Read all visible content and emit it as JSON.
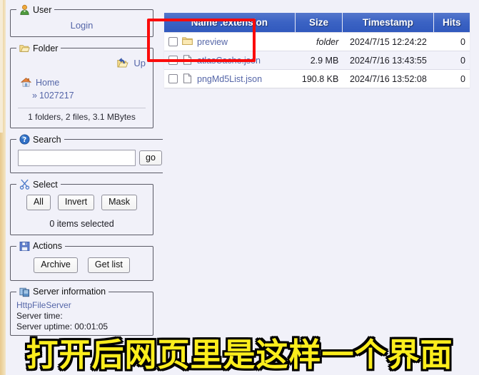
{
  "sidebar": {
    "user": {
      "legend": "User",
      "icon": "user-icon",
      "login_label": "Login"
    },
    "folder": {
      "legend": "Folder",
      "icon": "folder-open-icon",
      "up_label": "Up",
      "home_label": "Home",
      "breadcrumb_chevron": "»",
      "breadcrumb_label": "1027217",
      "stats": "1 folders, 2 files, 3.1 MBytes"
    },
    "search": {
      "legend": "Search",
      "icon": "help-icon",
      "value": "",
      "placeholder": "",
      "go_label": "go"
    },
    "select": {
      "legend": "Select",
      "icon": "scissors-icon",
      "buttons": [
        "All",
        "Invert",
        "Mask"
      ],
      "status": "0 items selected"
    },
    "actions": {
      "legend": "Actions",
      "icon": "save-icon",
      "buttons": [
        "Archive",
        "Get list"
      ]
    },
    "server": {
      "legend": "Server information",
      "icon": "server-icon",
      "product_link": "HttpFileServer",
      "time_line": "Server time:",
      "uptime_line": "Server uptime: 00:01:05"
    }
  },
  "table": {
    "columns": [
      "Name .extension",
      "Size",
      "Timestamp",
      "Hits"
    ],
    "rows": [
      {
        "icon": "folder-icon",
        "name": "preview",
        "size": "folder",
        "size_italic": true,
        "timestamp": "2024/7/15 12:24:22",
        "hits": "0"
      },
      {
        "icon": "file-icon",
        "name": "atlasCache.json",
        "size": "2.9 MB",
        "size_italic": false,
        "timestamp": "2024/7/16 13:43:55",
        "hits": "0"
      },
      {
        "icon": "file-icon",
        "name": "pngMd5List.json",
        "size": "190.8 KB",
        "size_italic": false,
        "timestamp": "2024/7/16 13:52:08",
        "hits": "0"
      }
    ]
  },
  "annotation": {
    "highlight_box_color": "#fb0b0b",
    "subtitle": "打开后网页里是这样一个界面",
    "subtitle_color": "#fbed1c"
  },
  "colors": {
    "header_blue": "#3b63c4",
    "link_blue": "#5566a8",
    "background": "#f1f1f9",
    "edge_strip": "#edd6a5"
  }
}
